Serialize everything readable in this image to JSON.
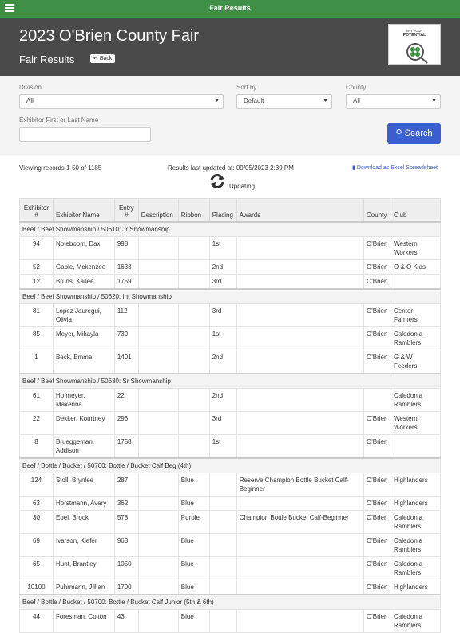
{
  "topbar": {
    "title": "Fair Results"
  },
  "header": {
    "title": "2023 O'Brien County Fair",
    "subtitle": "Fair Results",
    "back_label": "Back",
    "logo_line1": "SPY YOUR",
    "logo_line2": "POTENTIAL"
  },
  "filters": {
    "division_label": "Division",
    "division_value": "All",
    "sort_label": "Sort by",
    "sort_value": "Default",
    "county_label": "County",
    "county_value": "All",
    "name_label": "Exhibitor First or Last Name",
    "search_label": "Search"
  },
  "info": {
    "viewing": "Viewing records 1-50 of 1185",
    "updated": "Results last updated at: 09/05/2023 2:39 PM",
    "download": "Download as Excel Spreadsheet",
    "status": "Updating"
  },
  "colors": {
    "topbar": "#3f8f46",
    "header": "#4a4a4a",
    "accent": "#3b5fd1"
  },
  "table": {
    "headers": [
      "Exhibitor #",
      "Exhibitor Name",
      "Entry #",
      "Description",
      "Ribbon",
      "Placing",
      "Awards",
      "County",
      "Club"
    ],
    "groups": [
      {
        "title": "Beef / Beef Showmanship / 50610: Jr Showmanship",
        "rows": [
          [
            "94",
            "Noteboom, Dax",
            "998",
            "",
            "",
            "1st",
            "",
            "O'Brien",
            "Western Workers"
          ],
          [
            "52",
            "Gable, Mckenzee",
            "1633",
            "",
            "",
            "2nd",
            "",
            "O'Brien",
            "O & O Kids"
          ],
          [
            "12",
            "Bruns, Kailee",
            "1759",
            "",
            "",
            "3rd",
            "",
            "O'Brien",
            ""
          ]
        ]
      },
      {
        "title": "Beef / Beef Showmanship / 50620: Int Showmanship",
        "rows": [
          [
            "81",
            "Lopez Jauregui, Olivia",
            "112",
            "",
            "",
            "3rd",
            "",
            "O'Brien",
            "Center Farmers"
          ],
          [
            "85",
            "Meyer, Mikayla",
            "739",
            "",
            "",
            "1st",
            "",
            "O'Brien",
            "Caledonia Ramblers"
          ],
          [
            "1",
            "Beck, Emma",
            "1401",
            "",
            "",
            "2nd",
            "",
            "O'Brien",
            "G & W Feeders"
          ]
        ]
      },
      {
        "title": "Beef / Beef Showmanship / 50630: Sr Showmanship",
        "rows": [
          [
            "61",
            "Hofmeyer, Makenna",
            "22",
            "",
            "",
            "2nd",
            "",
            "",
            "Caledonia Ramblers"
          ],
          [
            "22",
            "Dekker, Kourtney",
            "296",
            "",
            "",
            "3rd",
            "",
            "O'Brien",
            "Western Workers"
          ],
          [
            "8",
            "Brueggeman, Addison",
            "1758",
            "",
            "",
            "1st",
            "",
            "O'Brien",
            ""
          ]
        ]
      },
      {
        "title": "Beef / Bottle / Bucket / 50700: Bottle / Bucket Calf Beg (4th)",
        "rows": [
          [
            "124",
            "Stoll, Brynlee",
            "287",
            "",
            "Blue",
            "",
            "Reserve Champion Bottle Bucket Calf-Beginner",
            "O'Brien",
            "Highlanders"
          ],
          [
            "63",
            "Horstmann, Avery",
            "362",
            "",
            "Blue",
            "",
            "",
            "O'Brien",
            "Highlanders"
          ],
          [
            "30",
            "Ebel, Brock",
            "578",
            "",
            "Purple",
            "",
            "Champion Bottle Bucket Calf-Beginner",
            "O'Brien",
            "Caledonia Ramblers"
          ],
          [
            "69",
            "Ivarson, Kiefer",
            "963",
            "",
            "Blue",
            "",
            "",
            "O'Brien",
            "Caledonia Ramblers"
          ],
          [
            "65",
            "Hunt, Brantley",
            "1050",
            "",
            "Blue",
            "",
            "",
            "O'Brien",
            "Caledonia Ramblers"
          ],
          [
            "10100",
            "Puhrmann, Jillian",
            "1700",
            "",
            "Blue",
            "",
            "",
            "O'Brien",
            "Highlanders"
          ]
        ]
      },
      {
        "title": "Beef / Bottle / Bucket / 50700: Bottle / Bucket Calf Junior (5th & 6th)",
        "rows": [
          [
            "44",
            "Foresman, Colton",
            "43",
            "",
            "Blue",
            "",
            "",
            "O'Brien",
            "Caledonia Ramblers"
          ]
        ]
      }
    ]
  }
}
